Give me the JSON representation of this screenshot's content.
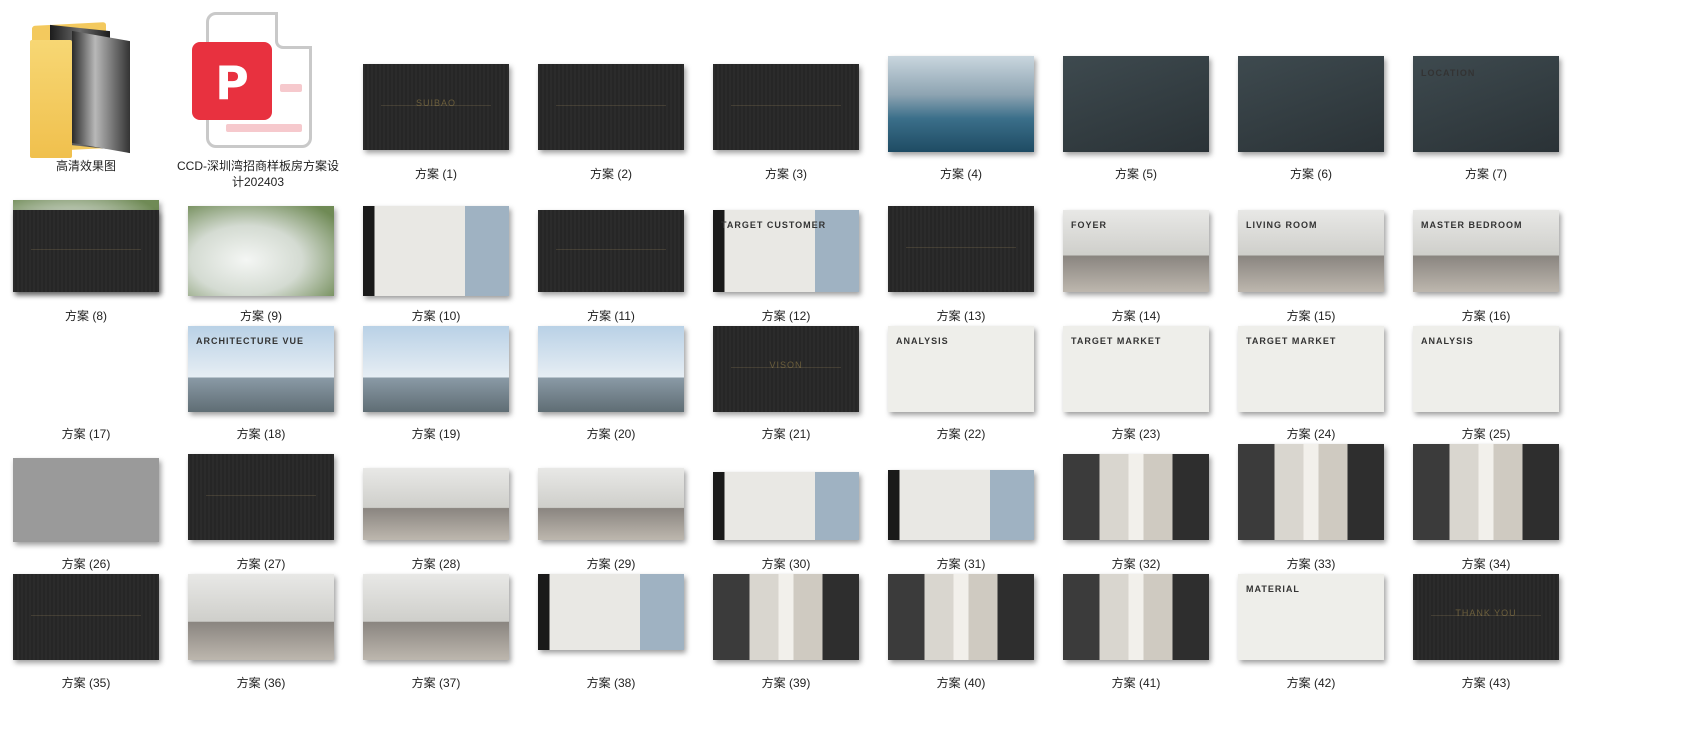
{
  "items": [
    {
      "label": "高清效果图",
      "kind": "folder",
      "icon": "folder-icon"
    },
    {
      "label": "CCD-深圳湾招商样板房方案设计202403",
      "kind": "pdf",
      "icon": "pdf-file-icon"
    },
    {
      "label": "方案 (1)",
      "style": "dark",
      "text": "SUIBAO"
    },
    {
      "label": "方案 (2)",
      "style": "dark"
    },
    {
      "label": "方案 (3)",
      "style": "dark"
    },
    {
      "label": "方案 (4)",
      "style": "sea"
    },
    {
      "label": "方案 (5)",
      "style": "slate"
    },
    {
      "label": "方案 (6)",
      "style": "slate"
    },
    {
      "label": "方案 (7)",
      "style": "slate",
      "text": "LOCATION"
    },
    {
      "label": "方案 (8)",
      "style": "mist"
    },
    {
      "label": "方案 (9)",
      "style": "mist"
    },
    {
      "label": "方案 (10)",
      "style": "room2"
    },
    {
      "label": "方案 (11)",
      "style": "dark"
    },
    {
      "label": "方案 (12)",
      "style": "room2",
      "text": "TARGET CUSTOMER"
    },
    {
      "label": "方案 (13)",
      "style": "dark"
    },
    {
      "label": "方案 (14)",
      "style": "room",
      "text": "FOYER"
    },
    {
      "label": "方案 (15)",
      "style": "room",
      "text": "LIVING ROOM"
    },
    {
      "label": "方案 (16)",
      "style": "room",
      "text": "MASTER BEDROOM"
    },
    {
      "label": "方案 (17)",
      "style": "dark"
    },
    {
      "label": "方案 (18)",
      "style": "tower",
      "text": "ARCHITECTURE VUE"
    },
    {
      "label": "方案 (19)",
      "style": "tower"
    },
    {
      "label": "方案 (20)",
      "style": "tower"
    },
    {
      "label": "方案 (21)",
      "style": "dark",
      "text": "VISON"
    },
    {
      "label": "方案 (22)",
      "style": "light",
      "text": "ANALYSIS"
    },
    {
      "label": "方案 (23)",
      "style": "light",
      "text": "TARGET MARKET"
    },
    {
      "label": "方案 (24)",
      "style": "light",
      "text": "TARGET MARKET"
    },
    {
      "label": "方案 (25)",
      "style": "light",
      "text": "ANALYSIS"
    },
    {
      "label": "方案 (26)",
      "style": "grey"
    },
    {
      "label": "方案 (27)",
      "style": "dark"
    },
    {
      "label": "方案 (28)",
      "style": "room"
    },
    {
      "label": "方案 (29)",
      "style": "room"
    },
    {
      "label": "方案 (30)",
      "style": "room2"
    },
    {
      "label": "方案 (31)",
      "style": "room2"
    },
    {
      "label": "方案 (32)",
      "style": "corr"
    },
    {
      "label": "方案 (33)",
      "style": "corr"
    },
    {
      "label": "方案 (34)",
      "style": "corr"
    },
    {
      "label": "方案 (35)",
      "style": "dark"
    },
    {
      "label": "方案 (36)",
      "style": "room"
    },
    {
      "label": "方案 (37)",
      "style": "room"
    },
    {
      "label": "方案 (38)",
      "style": "room2"
    },
    {
      "label": "方案 (39)",
      "style": "corr"
    },
    {
      "label": "方案 (40)",
      "style": "corr"
    },
    {
      "label": "方案 (41)",
      "style": "corr"
    },
    {
      "label": "方案 (42)",
      "style": "light",
      "text": "MATERIAL"
    },
    {
      "label": "方案 (43)",
      "style": "dark",
      "text": "THANK YOU"
    }
  ]
}
